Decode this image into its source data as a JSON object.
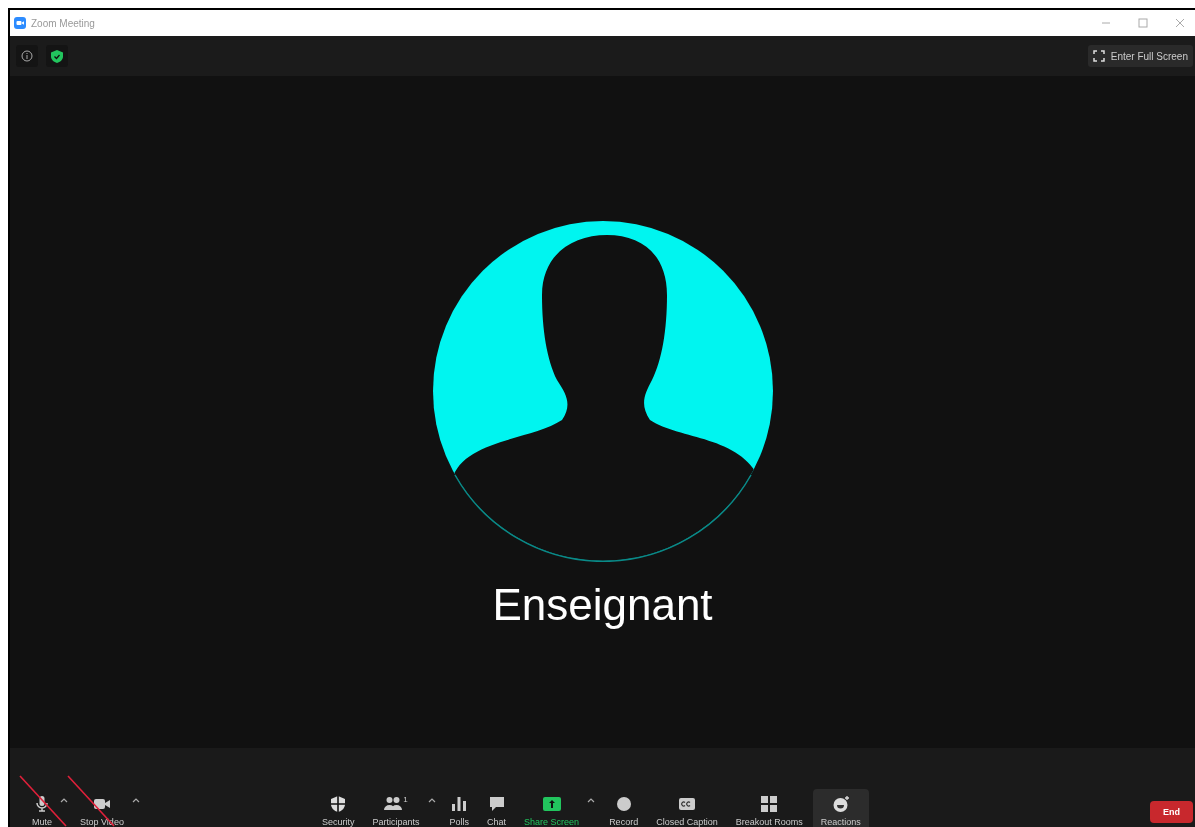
{
  "window": {
    "title": "Zoom Meeting"
  },
  "top_bar": {
    "full_screen_button": "Enter Full Screen"
  },
  "participant": {
    "name": "Enseignant"
  },
  "toolbar": {
    "left_items": [
      {
        "kind": "mic",
        "label": "Mute",
        "crossed": true,
        "has_menu": true,
        "selected": false
      },
      {
        "kind": "camera",
        "label": "Stop Video",
        "crossed": true,
        "has_menu": true,
        "selected": false
      }
    ],
    "center_items": [
      {
        "kind": "shield",
        "label": "Security",
        "crossed": false,
        "has_menu": false,
        "selected": false
      },
      {
        "kind": "people",
        "label": "Participants",
        "count": "1",
        "crossed": false,
        "has_menu": true,
        "selected": false
      },
      {
        "kind": "polls",
        "label": "Polls",
        "crossed": false,
        "has_menu": false,
        "selected": false
      },
      {
        "kind": "chat",
        "label": "Chat",
        "crossed": false,
        "has_menu": false,
        "selected": false
      },
      {
        "kind": "share",
        "label": "Share Screen",
        "crossed": false,
        "has_menu": true,
        "selected": false
      },
      {
        "kind": "record",
        "label": "Record",
        "crossed": false,
        "has_menu": false,
        "selected": false
      },
      {
        "kind": "cc",
        "label": "Closed Caption",
        "crossed": false,
        "has_menu": false,
        "selected": false
      },
      {
        "kind": "grid",
        "label": "Breakout Rooms",
        "crossed": false,
        "has_menu": false,
        "selected": false
      },
      {
        "kind": "reaction",
        "label": "Reactions",
        "crossed": false,
        "has_menu": false,
        "selected": true
      }
    ],
    "end_button": "End"
  }
}
